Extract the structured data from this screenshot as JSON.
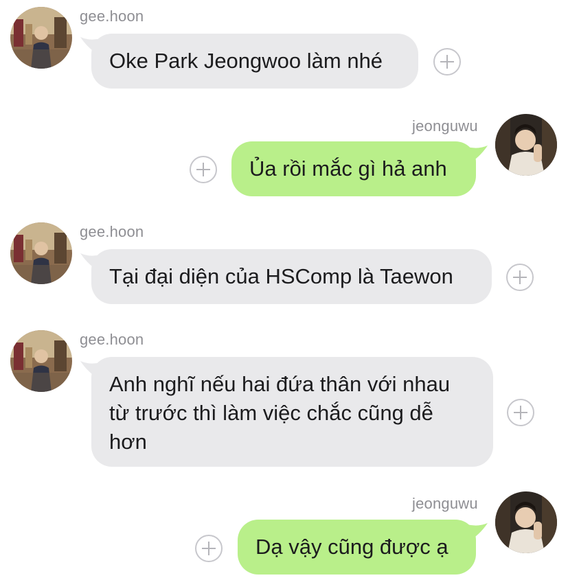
{
  "colors": {
    "incoming_bubble": "#e9e9eb",
    "outgoing_bubble": "#b9ef8a",
    "username_text": "#8e8e93",
    "message_text": "#1c1c1e",
    "plus_icon": "#c7c7cc"
  },
  "messages": [
    {
      "sender": "gee.hoon",
      "direction": "incoming",
      "text": "Oke Park Jeongwoo làm nhé"
    },
    {
      "sender": "jeonguwu",
      "direction": "outgoing",
      "text": "Ủa rồi mắc gì hả anh"
    },
    {
      "sender": "gee.hoon",
      "direction": "incoming",
      "text": "Tại đại diện của HSComp là Taewon"
    },
    {
      "sender": "gee.hoon",
      "direction": "incoming",
      "text": "Anh nghĩ nếu hai đứa thân với nhau từ trước thì làm việc chắc cũng dễ hơn"
    },
    {
      "sender": "jeonguwu",
      "direction": "outgoing",
      "text": "Dạ vậy cũng được ạ"
    }
  ],
  "icons": {
    "reaction_add": "plus-circle-icon",
    "avatar_geehoon": "avatar-photo",
    "avatar_jeonguwu": "avatar-photo"
  }
}
